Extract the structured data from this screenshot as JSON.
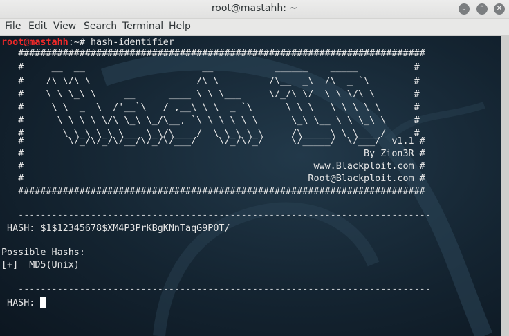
{
  "window": {
    "title": "root@mastahh: ~",
    "controls": {
      "minimize": "⌄",
      "maximize": "⌃",
      "close": "✕"
    }
  },
  "menu": [
    "File",
    "Edit",
    "View",
    "Search",
    "Terminal",
    "Help"
  ],
  "terminal": {
    "prompt_user": "root@mastahh",
    "prompt_path": ":~# ",
    "command": "hash-identifier",
    "banner": [
      "   #########################################################################",
      "   #     __  __                     __           ______    _____          #",
      "   #    /\\ \\/\\ \\                   /\\ \\         /\\__  _\\  /\\  _ `\\        #",
      "   #    \\ \\ \\_\\ \\     __      ____ \\ \\ \\___     \\/_/\\ \\/  \\ \\ \\/\\ \\       #",
      "   #     \\ \\  _  \\  /'__`\\   / ,__\\ \\ \\  _ `\\      \\ \\ \\   \\ \\ \\ \\ \\      #",
      "   #      \\ \\ \\ \\ \\/\\ \\_\\ \\_/\\__, `\\ \\ \\ \\ \\ \\      \\_\\ \\__ \\ \\ \\_\\ \\     #",
      "   #       \\ \\_\\ \\_\\ \\___ \\_\\/\\____/  \\ \\_\\ \\_\\     /\\_____\\ \\ \\____/     #",
      "   #        \\/_/\\/_/\\/__/\\/_/\\/___/    \\/_/\\/_/     \\/_____/  \\/___/  v1.1 #",
      "   #                                                             By Zion3R #",
      "   #                                                    www.Blackploit.com #",
      "   #                                                   Root@Blackploit.com #",
      "   #########################################################################"
    ],
    "separator": "   --------------------------------------------------------------------------",
    "hash_label": " HASH: ",
    "hash_value": "$1$12345678$XM4P3PrKBgKNnTaqG9P0T/",
    "possible_label": "Possible Hashs:",
    "result": "[+]  MD5(Unix)",
    "hash_prompt": " HASH: "
  },
  "colors": {
    "terminal_bg": "#142431",
    "prompt_user": "#ef2929",
    "text": "#e6e6e6"
  }
}
